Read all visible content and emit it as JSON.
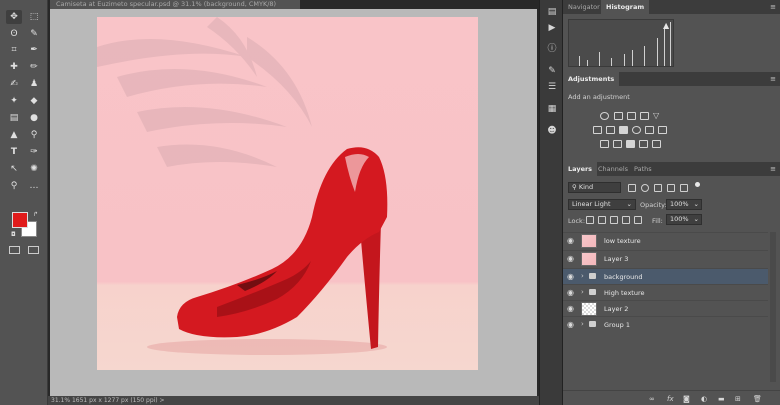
{
  "document": {
    "tab_title": "Camiseta at Euzimeto specular.psd @ 31.1% (background, CMYK/8)",
    "status_text": "31.1%    1651 px x 1277 px (150 ppi)    >"
  },
  "toolbar": {
    "tools": [
      {
        "name": "move-tool",
        "glyph": "✥"
      },
      {
        "name": "marquee-tool",
        "glyph": "⬚"
      },
      {
        "name": "lasso-tool",
        "glyph": "ʘ"
      },
      {
        "name": "quick-select-tool",
        "glyph": "✎"
      },
      {
        "name": "crop-tool",
        "glyph": "⌗"
      },
      {
        "name": "eyedropper-tool",
        "glyph": "✒"
      },
      {
        "name": "healing-tool",
        "glyph": "✚"
      },
      {
        "name": "pencil-tool",
        "glyph": "✏"
      },
      {
        "name": "brush-tool",
        "glyph": "✍"
      },
      {
        "name": "stamp-tool",
        "glyph": "♟"
      },
      {
        "name": "history-brush-tool",
        "glyph": "✦"
      },
      {
        "name": "eraser-tool",
        "glyph": "◆"
      },
      {
        "name": "gradient-tool",
        "glyph": "▤"
      },
      {
        "name": "blur-tool",
        "glyph": "●"
      },
      {
        "name": "dodge-tool",
        "glyph": "▲"
      },
      {
        "name": "burn-tool",
        "glyph": "⚲"
      },
      {
        "name": "type-tool",
        "glyph": "T"
      },
      {
        "name": "pen-tool",
        "glyph": "✑"
      },
      {
        "name": "path-select-tool",
        "glyph": "↖"
      },
      {
        "name": "shape-tool",
        "glyph": "✺"
      },
      {
        "name": "zoom-tool",
        "glyph": "⚲"
      },
      {
        "name": "more-tools",
        "glyph": "…"
      }
    ],
    "foreground_color": "#e01b1b",
    "background_color": "#ffffff"
  },
  "dock": {
    "icons": [
      "history-icon",
      "play-icon",
      "info-icon",
      "brush-settings-icon",
      "adjust-icon",
      "properties-icon",
      "people-icon"
    ]
  },
  "panels": {
    "top_tabs": [
      "Navigator",
      "Histogram"
    ],
    "adjustments_tab": "Adjustments",
    "adjustments_hint": "Add an adjustment",
    "layers_tabs": [
      "Layers",
      "Channels",
      "Paths"
    ],
    "filter_kind": "Kind",
    "blend_mode": "Linear Light",
    "opacity_label": "Opacity:",
    "opacity_value": "100%",
    "lock_label": "Lock:",
    "fill_label": "Fill:",
    "fill_value": "100%",
    "layers": [
      {
        "name": "low texture"
      },
      {
        "name": "Layer 3"
      },
      {
        "name": "background"
      },
      {
        "name": "High texture"
      },
      {
        "name": "Layer 2"
      },
      {
        "name": "Group 1"
      }
    ]
  },
  "colors": {
    "selection_blue": "#4b5a6c",
    "shoe_red": "#d41920",
    "canvas_pink": "#f9c4c8"
  }
}
